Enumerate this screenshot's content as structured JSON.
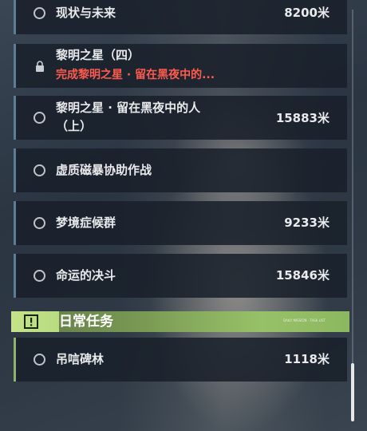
{
  "tasks_before": [
    {
      "title": "现状与未来",
      "distance": "8200米",
      "state": "open"
    },
    {
      "title": "黎明之星（四）",
      "subtitle": "完成黎明之星 · 留在黑夜中的...",
      "state": "locked"
    },
    {
      "title_line1": "黎明之星 · 留在黑夜中的人",
      "title_line2": "（上）",
      "distance": "15883米",
      "state": "open"
    },
    {
      "title": "虚质磁暴协助作战",
      "state": "open"
    },
    {
      "title": "梦境症候群",
      "distance": "9233米",
      "state": "open"
    },
    {
      "title": "命运的决斗",
      "distance": "15846米",
      "state": "open"
    }
  ],
  "daily_section": {
    "title": "日常任务",
    "tag": "DAILY MISSION · TASK LIST"
  },
  "daily_tasks": [
    {
      "title": "吊唁碑林",
      "distance": "1118米",
      "state": "open"
    }
  ],
  "icons": {
    "open": "radio-circle-icon",
    "locked": "lock-icon",
    "section": "exclamation-box-icon"
  },
  "colors": {
    "accent_blue": "#5d7d96",
    "accent_green": "#a8cf73",
    "warning_red": "#ff5a4e"
  }
}
